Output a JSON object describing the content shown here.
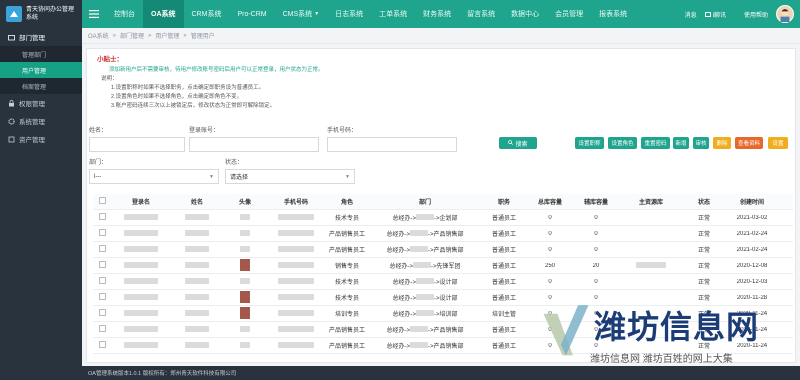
{
  "app": {
    "title": "青天协同办公管理系统"
  },
  "sidebar": {
    "items": [
      {
        "label": "部门管理"
      },
      {
        "label": "管理部门"
      },
      {
        "label": "用户管理"
      },
      {
        "label": "档案管理"
      },
      {
        "label": "权限管理"
      },
      {
        "label": "系统管理"
      },
      {
        "label": "资产管理"
      }
    ]
  },
  "topnav": {
    "items": [
      "控制台",
      "OA系统",
      "CRM系统",
      "Pro-CRM",
      "CMS系统",
      "日志系统",
      "工单系统",
      "财务系统",
      "留言系统",
      "数据中心",
      "会员管理",
      "报表系统"
    ],
    "right": {
      "messages": "消息",
      "chat": "i聊讯",
      "help": "使用帮助"
    }
  },
  "breadcrumb": [
    "OA系统",
    "部门管理",
    "用户管理",
    "管理用户"
  ],
  "tips": {
    "title": "小贴士：",
    "lines": [
      "添加新用户后不需要审核，待用户修改账号密码后用户可以正常登录，用户状态为正常。",
      "说明：",
      "1.设置职称时如果不选择职务，点击确定即职务设为普通员工。",
      "2.设置角色时如果不选择角色，点击确定即角色不变。",
      "3.账户密码连续三次以上被锁定后，修改状态为正常即可解除锁定。"
    ]
  },
  "filters": {
    "name_label": "姓名：",
    "account_label": "登录账号：",
    "phone_label": "手机号码：",
    "dept_label": "部门：",
    "dept_value": "l---",
    "status_label": "状态：",
    "status_value": "请选择"
  },
  "search_button": "搜索",
  "actions": [
    {
      "label": "设置职称",
      "color": "#1fa58e"
    },
    {
      "label": "设置角色",
      "color": "#1fa58e"
    },
    {
      "label": "重置密码",
      "color": "#1fa58e"
    },
    {
      "label": "新增",
      "color": "#1fa58e"
    },
    {
      "label": "审核",
      "color": "#1fa58e"
    },
    {
      "label": "删除",
      "color": "#f0ad1e"
    },
    {
      "label": "查看资料",
      "color": "#e8672a"
    },
    {
      "label": "设置",
      "color": "#f0ad1e"
    }
  ],
  "table": {
    "columns": [
      "登录名",
      "姓名",
      "头像",
      "手机号码",
      "角色",
      "部门",
      "职务",
      "总库容量",
      "辅库容量",
      "主资源库",
      "状态",
      "创建时间"
    ],
    "rows": [
      {
        "role": "技术专员",
        "dept_a": "总经办->",
        "dept_b": "->企划部",
        "position": "普通员工",
        "total": "0",
        "aux": "0",
        "status": "正常",
        "date": "2021-03-02"
      },
      {
        "role": "产品销售员工",
        "dept_a": "总经办->",
        "dept_b": "->产品销售部",
        "position": "普通员工",
        "total": "0",
        "aux": "0",
        "status": "正常",
        "date": "2021-02-24"
      },
      {
        "role": "产品销售员工",
        "dept_a": "总经办->",
        "dept_b": "->产品销售部",
        "position": "普通员工",
        "total": "0",
        "aux": "0",
        "status": "正常",
        "date": "2021-02-24"
      },
      {
        "role": "销售专员",
        "dept_a": "总经办->",
        "dept_b": "->先锋军团",
        "position": "普通员工",
        "total": "250",
        "aux": "20",
        "status": "正常",
        "date": "2020-12-08"
      },
      {
        "role": "技术专员",
        "dept_a": "总经办->",
        "dept_b": "->设计部",
        "position": "普通员工",
        "total": "0",
        "aux": "0",
        "status": "正常",
        "date": "2020-12-03"
      },
      {
        "role": "技术专员",
        "dept_a": "总经办->",
        "dept_b": "->设计部",
        "position": "普通员工",
        "total": "0",
        "aux": "0",
        "status": "正常",
        "date": "2020-11-28"
      },
      {
        "role": "培训专员",
        "dept_a": "总经办->",
        "dept_b": "->培训部",
        "position": "培训主管",
        "total": "0",
        "aux": "0",
        "status": "正常",
        "date": "2020-11-24"
      },
      {
        "role": "产品销售员工",
        "dept_a": "总经办->",
        "dept_b": "->产品销售部",
        "position": "普通员工",
        "total": "0",
        "aux": "0",
        "status": "正常",
        "date": "2020-11-24"
      },
      {
        "role": "产品销售员工",
        "dept_a": "总经办->",
        "dept_b": "->产品销售部",
        "position": "普通员工",
        "total": "0",
        "aux": "0",
        "status": "正常",
        "date": "2020-11-24"
      }
    ]
  },
  "footer": "OA管理系统版本1.0.1 版权所有：郑州青天软件科技有限公司",
  "watermark": {
    "main": "潍坊信息网",
    "sub": "潍坊信息网 潍坊百姓的网上大集"
  },
  "colors": {
    "primary": "#1fa58e",
    "sidebar": "#28333e",
    "warning": "#f0ad1e",
    "danger": "#e8672a"
  }
}
